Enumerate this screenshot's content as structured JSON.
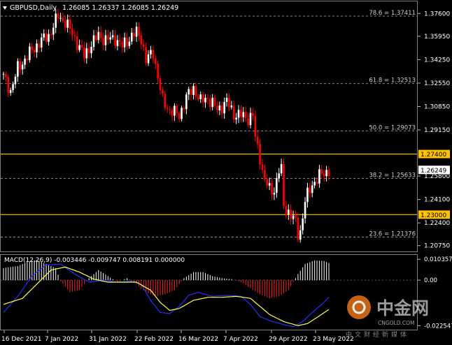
{
  "header": {
    "symbol_timeframe": "GBPUSD,Daily",
    "ohlc": "1.26085 1.26337 1.26085 1.26249"
  },
  "macd_header": "MACD(12,26,9) -0.003446 -0.009747 0.008191 0.000000",
  "price_axis": {
    "labels": [
      "1.37600",
      "1.35950",
      "1.34250",
      "1.32550",
      "1.30850",
      "1.29150",
      "1.25800",
      "1.24100",
      "1.22400",
      "1.20750"
    ],
    "values": [
      1.376,
      1.3595,
      1.3425,
      1.3255,
      1.3085,
      1.2915,
      1.258,
      1.241,
      1.224,
      1.2075
    ],
    "range": [
      1.2033,
      1.3848
    ]
  },
  "current_price": {
    "label": "1.26249",
    "value": 1.26249
  },
  "levels": {
    "fib": [
      {
        "label": "78.6 = 1.37411",
        "value": 1.37411
      },
      {
        "label": "61.8 = 1.32513",
        "value": 1.32513
      },
      {
        "label": "50.0 = 1.29073",
        "value": 1.29073
      },
      {
        "label": "38.2 = 1.25633",
        "value": 1.25633
      },
      {
        "label": "23.6 = 1.21376",
        "value": 1.21376
      }
    ],
    "horizontal": [
      {
        "label": "1.27400",
        "value": 1.274
      },
      {
        "label": "1.23000",
        "value": 1.23
      }
    ]
  },
  "macd_axis": {
    "labels": [
      "0.010357",
      "0.00",
      "-0.022547"
    ],
    "values": [
      0.010357,
      0,
      -0.022547
    ],
    "range": [
      -0.0245,
      0.0125
    ]
  },
  "date_axis": {
    "labels": [
      "16 Dec 2021",
      "7 Jan 2022",
      "31 Jan 2022",
      "22 Feb 2022",
      "16 Mar 2022",
      "7 Apr 2022",
      "29 Apr 2022",
      "23 May 2022"
    ]
  },
  "watermark": {
    "cn": "中金网",
    "url": "CNGOLD.COM",
    "cn_sub": "中文财经新媒体"
  },
  "colors": {
    "bull": "#ffffff",
    "bear": "#ff0000",
    "grid": "#6a6a6a",
    "hline": "#ffc000",
    "macd_pos": "#ffffff",
    "macd_neg": "#ff2020",
    "macd_line": "#2030ff",
    "signal_line": "#ffff40"
  },
  "chart_data": {
    "type": "candlestick",
    "series_name": "GBPUSD,Daily",
    "close_waypoints": [
      [
        0,
        1.33
      ],
      [
        3,
        1.32
      ],
      [
        6,
        1.336
      ],
      [
        10,
        1.345
      ],
      [
        15,
        1.355
      ],
      [
        19,
        1.36
      ],
      [
        23,
        1.374
      ],
      [
        26,
        1.37
      ],
      [
        30,
        1.358
      ],
      [
        34,
        1.345
      ],
      [
        37,
        1.354
      ],
      [
        40,
        1.36
      ],
      [
        43,
        1.357
      ],
      [
        47,
        1.358
      ],
      [
        50,
        1.352
      ],
      [
        54,
        1.36
      ],
      [
        56,
        1.362
      ],
      [
        58,
        1.358
      ],
      [
        60,
        1.342
      ],
      [
        63,
        1.348
      ],
      [
        67,
        1.312
      ],
      [
        70,
        1.306
      ],
      [
        74,
        1.302
      ],
      [
        77,
        1.315
      ],
      [
        80,
        1.322
      ],
      [
        83,
        1.312
      ],
      [
        86,
        1.315
      ],
      [
        90,
        1.306
      ],
      [
        94,
        1.312
      ],
      [
        97,
        1.303
      ],
      [
        100,
        1.302
      ],
      [
        103,
        1.3
      ],
      [
        105,
        1.302
      ],
      [
        106,
        1.285
      ],
      [
        108,
        1.272
      ],
      [
        109,
        1.262
      ],
      [
        110,
        1.255
      ],
      [
        112,
        1.248
      ],
      [
        114,
        1.248
      ],
      [
        116,
        1.262
      ],
      [
        117,
        1.262
      ],
      [
        118,
        1.236
      ],
      [
        120,
        1.232
      ],
      [
        123,
        1.224
      ],
      [
        124,
        1.216
      ],
      [
        125,
        1.218
      ],
      [
        127,
        1.24
      ],
      [
        130,
        1.252
      ],
      [
        133,
        1.258
      ],
      [
        135,
        1.26
      ],
      [
        137,
        1.2625
      ]
    ],
    "macd_hist_waypoints": [
      [
        0,
        0.006
      ],
      [
        6,
        0.007
      ],
      [
        10,
        0.009
      ],
      [
        14,
        0.01
      ],
      [
        18,
        0.008
      ],
      [
        22,
        0.006
      ],
      [
        24,
        -0.0005
      ],
      [
        28,
        -0.006
      ],
      [
        32,
        -0.005
      ],
      [
        36,
        0.001
      ],
      [
        40,
        0.005
      ],
      [
        44,
        0.002
      ],
      [
        48,
        -0.001
      ],
      [
        52,
        0.001
      ],
      [
        56,
        -0.002
      ],
      [
        60,
        -0.006
      ],
      [
        64,
        -0.008
      ],
      [
        68,
        -0.007
      ],
      [
        72,
        -0.005
      ],
      [
        76,
        0.001
      ],
      [
        80,
        0.004
      ],
      [
        84,
        0.004
      ],
      [
        88,
        0.002
      ],
      [
        92,
        0.001
      ],
      [
        96,
        0.0005
      ],
      [
        100,
        -0.001
      ],
      [
        104,
        -0.004
      ],
      [
        108,
        -0.007
      ],
      [
        112,
        -0.009
      ],
      [
        116,
        -0.008
      ],
      [
        120,
        -0.005
      ],
      [
        124,
        0.003
      ],
      [
        127,
        0.008
      ],
      [
        131,
        0.0098
      ],
      [
        135,
        0.0095
      ],
      [
        137,
        0.0085
      ]
    ],
    "macd_line_waypoints": [
      [
        0,
        -0.016
      ],
      [
        6,
        -0.008
      ],
      [
        12,
        0.002
      ],
      [
        18,
        0.0075
      ],
      [
        24,
        0.008
      ],
      [
        30,
        0.003
      ],
      [
        36,
        -0.001
      ],
      [
        42,
        0.0
      ],
      [
        48,
        -0.001
      ],
      [
        54,
        -0.0005
      ],
      [
        58,
        -0.002
      ],
      [
        62,
        -0.01
      ],
      [
        66,
        -0.016
      ],
      [
        70,
        -0.0165
      ],
      [
        74,
        -0.013
      ],
      [
        78,
        -0.0075
      ],
      [
        82,
        -0.006
      ],
      [
        88,
        -0.008
      ],
      [
        94,
        -0.0075
      ],
      [
        100,
        -0.008
      ],
      [
        104,
        -0.012
      ],
      [
        108,
        -0.018
      ],
      [
        112,
        -0.02
      ],
      [
        118,
        -0.022
      ],
      [
        122,
        -0.023
      ],
      [
        126,
        -0.0205
      ],
      [
        130,
        -0.016
      ],
      [
        134,
        -0.012
      ],
      [
        137,
        -0.0085
      ]
    ],
    "signal_line_waypoints": [
      [
        0,
        -0.012
      ],
      [
        8,
        -0.009
      ],
      [
        14,
        -0.002
      ],
      [
        20,
        0.005
      ],
      [
        26,
        0.0065
      ],
      [
        32,
        0.004
      ],
      [
        38,
        0.0005
      ],
      [
        44,
        -0.001
      ],
      [
        50,
        -0.001
      ],
      [
        56,
        -0.001
      ],
      [
        62,
        -0.005
      ],
      [
        66,
        -0.011
      ],
      [
        70,
        -0.015
      ],
      [
        74,
        -0.014
      ],
      [
        80,
        -0.01
      ],
      [
        86,
        -0.0085
      ],
      [
        92,
        -0.0085
      ],
      [
        98,
        -0.008
      ],
      [
        104,
        -0.009
      ],
      [
        108,
        -0.013
      ],
      [
        112,
        -0.017
      ],
      [
        118,
        -0.0205
      ],
      [
        124,
        -0.0225
      ],
      [
        128,
        -0.0215
      ],
      [
        132,
        -0.0185
      ],
      [
        137,
        -0.0145
      ]
    ]
  }
}
